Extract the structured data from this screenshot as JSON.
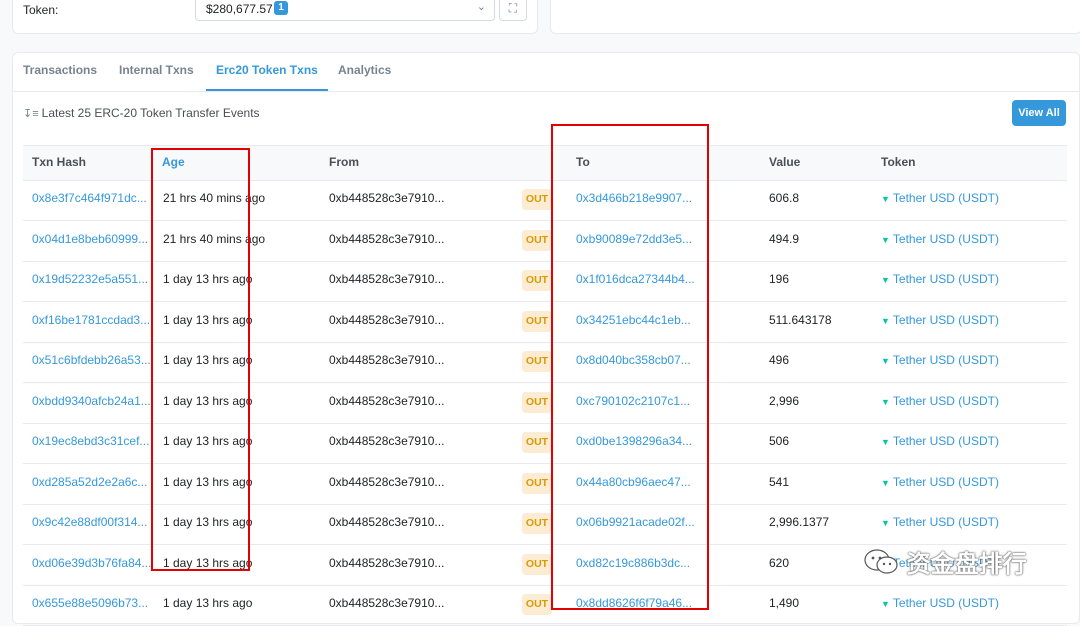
{
  "token_panel": {
    "label": "Token:",
    "value": "$280,677.57",
    "badge": "1"
  },
  "tabs": [
    {
      "label": "Transactions",
      "active": false
    },
    {
      "label": "Internal Txns",
      "active": false
    },
    {
      "label": "Erc20 Token Txns",
      "active": true
    },
    {
      "label": "Analytics",
      "active": false
    }
  ],
  "events_caption": "Latest 25 ERC-20 Token Transfer Events",
  "view_all_label": "View All",
  "columns": {
    "txn_hash": "Txn Hash",
    "age": "Age",
    "from": "From",
    "to": "To",
    "value": "Value",
    "token": "Token"
  },
  "direction_label": "OUT",
  "rows": [
    {
      "hash": "0x8e3f7c464f971dc...",
      "age": "21 hrs 40 mins ago",
      "from": "0xb448528c3e7910...",
      "to": "0x3d466b218e9907...",
      "value": "606.8",
      "token": "Tether USD (USDT)"
    },
    {
      "hash": "0x04d1e8beb60999...",
      "age": "21 hrs 40 mins ago",
      "from": "0xb448528c3e7910...",
      "to": "0xb90089e72dd3e5...",
      "value": "494.9",
      "token": "Tether USD (USDT)"
    },
    {
      "hash": "0x19d52232e5a551...",
      "age": "1 day 13 hrs ago",
      "from": "0xb448528c3e7910...",
      "to": "0x1f016dca27344b4...",
      "value": "196",
      "token": "Tether USD (USDT)"
    },
    {
      "hash": "0xf16be1781ccdad3...",
      "age": "1 day 13 hrs ago",
      "from": "0xb448528c3e7910...",
      "to": "0x34251ebc44c1eb...",
      "value": "511.643178",
      "token": "Tether USD (USDT)"
    },
    {
      "hash": "0x51c6bfdebb26a53...",
      "age": "1 day 13 hrs ago",
      "from": "0xb448528c3e7910...",
      "to": "0x8d040bc358cb07...",
      "value": "496",
      "token": "Tether USD (USDT)"
    },
    {
      "hash": "0xbdd9340afcb24a1...",
      "age": "1 day 13 hrs ago",
      "from": "0xb448528c3e7910...",
      "to": "0xc790102c2107c1...",
      "value": "2,996",
      "token": "Tether USD (USDT)"
    },
    {
      "hash": "0x19ec8ebd3c31cef...",
      "age": "1 day 13 hrs ago",
      "from": "0xb448528c3e7910...",
      "to": "0xd0be1398296a34...",
      "value": "506",
      "token": "Tether USD (USDT)"
    },
    {
      "hash": "0xd285a52d2e2a6c...",
      "age": "1 day 13 hrs ago",
      "from": "0xb448528c3e7910...",
      "to": "0x44a80cb96aec47...",
      "value": "541",
      "token": "Tether USD (USDT)"
    },
    {
      "hash": "0x9c42e88df00f314...",
      "age": "1 day 13 hrs ago",
      "from": "0xb448528c3e7910...",
      "to": "0x06b9921acade02f...",
      "value": "2,996.1377",
      "token": "Tether USD (USDT)"
    },
    {
      "hash": "0xd06e39d3b76fa84...",
      "age": "1 day 13 hrs ago",
      "from": "0xb448528c3e7910...",
      "to": "0xd82c19c886b3dc...",
      "value": "620",
      "token": "Tether USD (USDT)"
    },
    {
      "hash": "0x655e88e5096b73...",
      "age": "1 day 13 hrs ago",
      "from": "0xb448528c3e7910...",
      "to": "0x8dd8626f6f79a46...",
      "value": "1,490",
      "token": "Tether USD (USDT)"
    }
  ],
  "watermark_text": "资金盘排行",
  "colors": {
    "link": "#3498db",
    "highlight_box": "#e30000",
    "out_badge_bg": "#fbecd3",
    "out_badge_text": "#db9a04",
    "tether_icon": "#00c9a7"
  },
  "icons": {
    "sort": "sort-desc-icon",
    "expand": "expand-icon",
    "dropdown": "chevron-down-icon",
    "token": "tether-icon",
    "watermark": "wechat-icon"
  }
}
